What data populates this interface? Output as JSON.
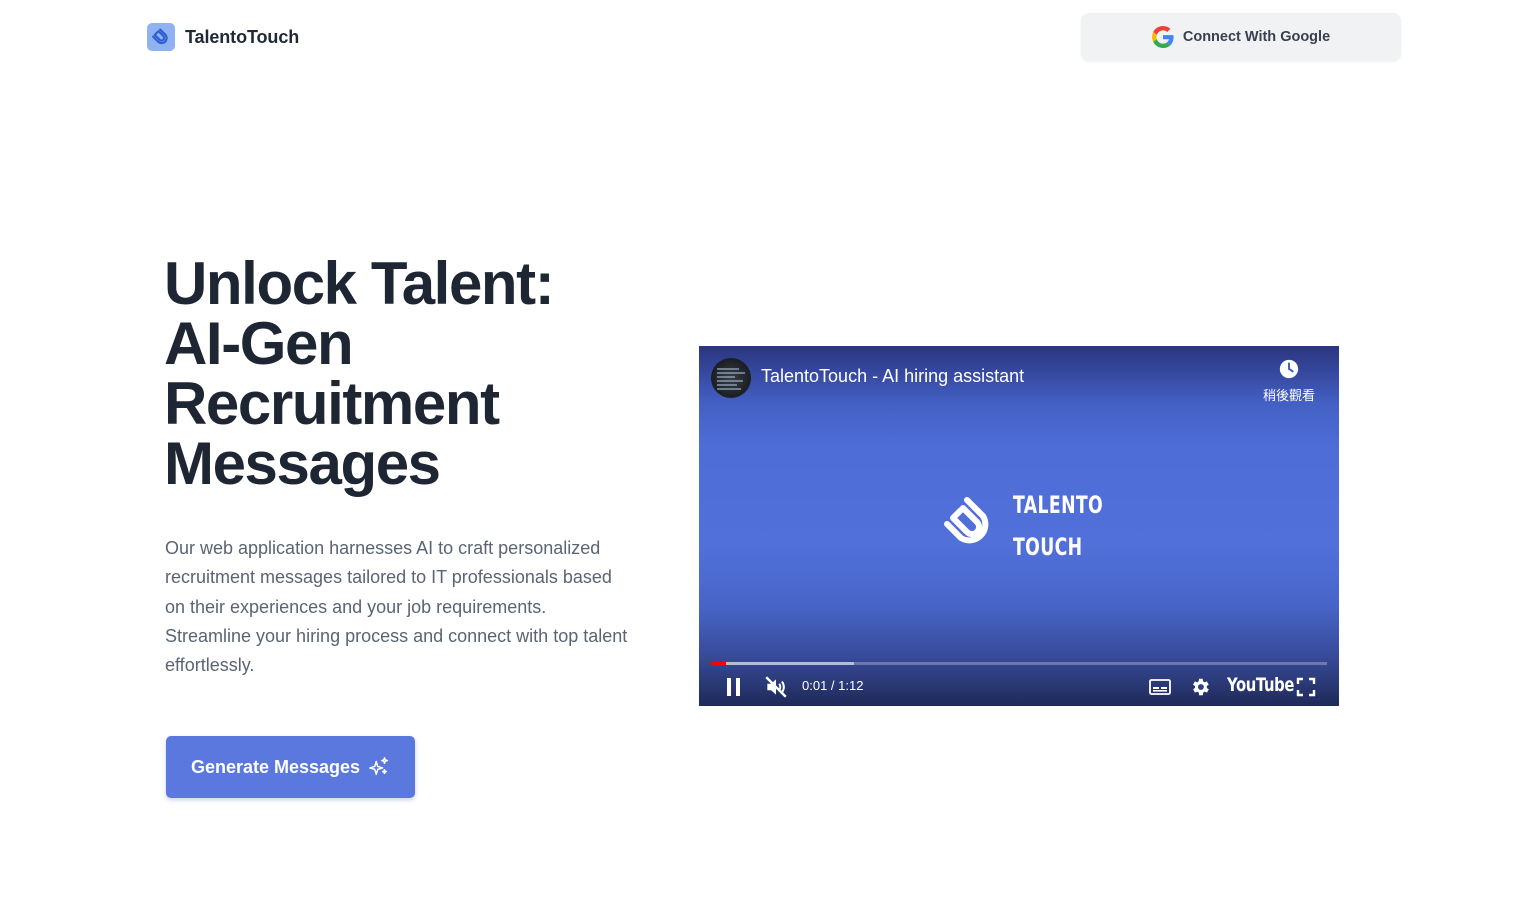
{
  "brand": {
    "name": "TalentoTouch",
    "logo_icon": "magnet-icon",
    "logo_color": "#8fb3f0"
  },
  "header": {
    "google_button": {
      "label": "Connect With Google",
      "icon": "google-icon"
    }
  },
  "hero": {
    "title_lines": [
      "Unlock Talent:",
      "AI-Gen",
      "Recruitment",
      "Messages"
    ],
    "description": "Our web application harnesses AI to craft personalized recruitment messages tailored to IT professionals based on their experiences and your job requirements. Streamline your hiring process and connect with top talent effortlessly.",
    "cta": {
      "label": "Generate Messages",
      "icon": "sparkle-icon",
      "color": "#5a78dd"
    }
  },
  "video": {
    "title": "TalentoTouch - AI hiring assistant",
    "watch_later_label": "稍後觀看",
    "wordmark_lines": [
      "TALENTO",
      "TOUCH"
    ],
    "time_display": "0:01 / 1:12",
    "played_fraction": 0.024,
    "buffered_fraction": 0.232,
    "platform_label": "YouTube",
    "state": "playing",
    "muted": true,
    "background_color": "#5170d9"
  }
}
